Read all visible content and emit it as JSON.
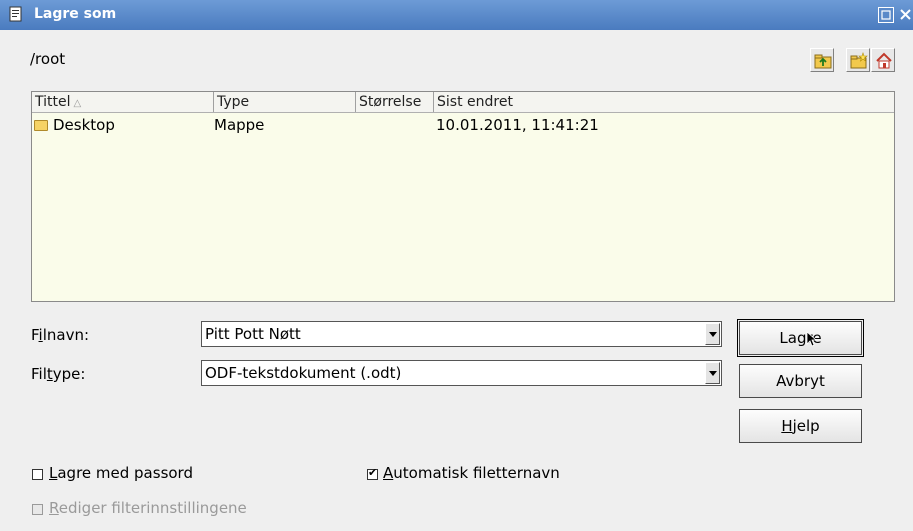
{
  "window": {
    "title": "Lagre som",
    "title_color": "#5083c8"
  },
  "path": "/root",
  "toolbar": {
    "icons": [
      "folder-up-icon",
      "new-folder-icon",
      "home-icon"
    ]
  },
  "file_list": {
    "columns": [
      "Tittel",
      "Type",
      "Størrelse",
      "Sist endret"
    ],
    "rows": [
      {
        "name": "Desktop",
        "type": "Mappe",
        "size": "",
        "modified": "10.01.2011, 11:41:21"
      }
    ],
    "background": "#fafcea"
  },
  "filename": {
    "label_a": "F",
    "label_u": "i",
    "label_b": "lnavn:",
    "value": "Pitt Pott Nøtt"
  },
  "filetype": {
    "label_a": "Fil",
    "label_u": "t",
    "label_b": "ype:",
    "value": "ODF-tekstdokument (.odt)"
  },
  "buttons": {
    "save": {
      "pre": "Lag",
      "post": "re"
    },
    "cancel": "Avbryt",
    "help": {
      "u": "H",
      "rest": "jelp"
    }
  },
  "options": {
    "password": {
      "u": "L",
      "rest": "agre med passord",
      "checked": false
    },
    "auto_ext": {
      "u": "A",
      "rest": "utomatisk filetternavn",
      "checked": true
    },
    "filter_settings": {
      "u": "R",
      "rest": "ediger filterinnstillingene",
      "checked": false,
      "enabled": false
    }
  }
}
